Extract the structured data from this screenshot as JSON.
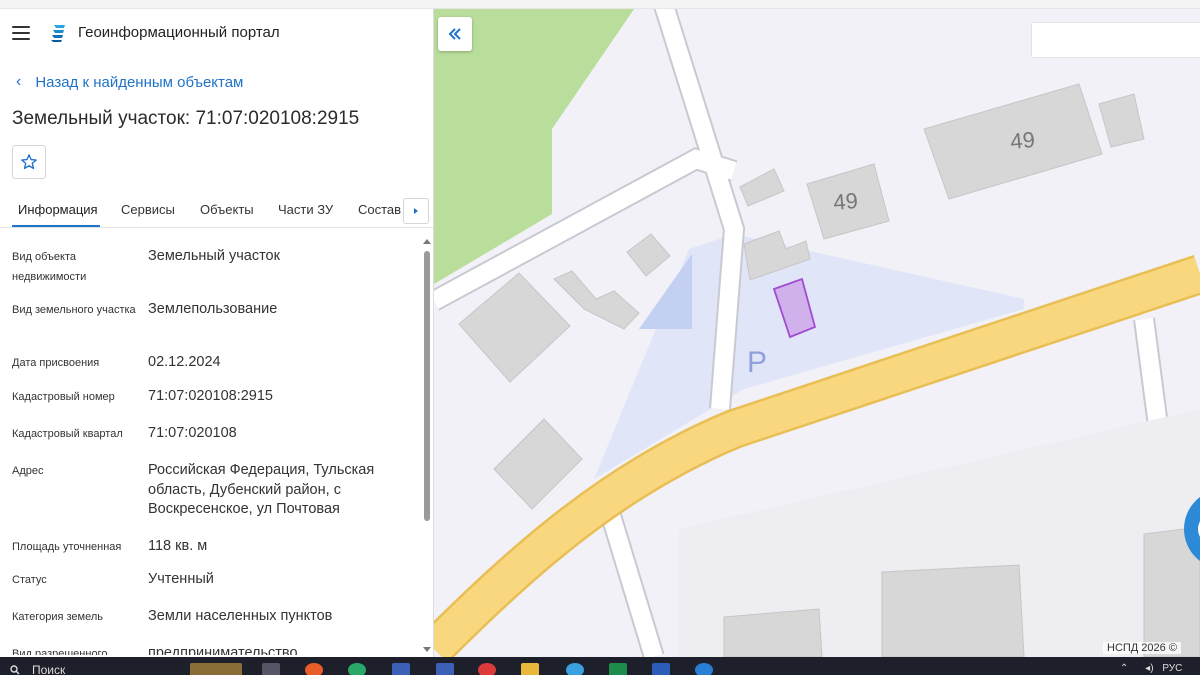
{
  "header": {
    "menu_icon": "hamburger-icon",
    "logo_icon": "portal-logo-icon",
    "title": "Геоинформационный портал"
  },
  "nav": {
    "back_label": "Назад к найденным объектам"
  },
  "object": {
    "title": "Земельный участок: 71:07:020108:2915",
    "favorite_icon": "star-icon"
  },
  "tabs": [
    {
      "label": "Информация",
      "active": true
    },
    {
      "label": "Сервисы",
      "active": false
    },
    {
      "label": "Объекты",
      "active": false
    },
    {
      "label": "Части ЗУ",
      "active": false
    },
    {
      "label": "Состав",
      "active": false
    }
  ],
  "properties": [
    {
      "label": "Вид объекта недвижимости",
      "value": "Земельный участок"
    },
    {
      "label": "Вид земельного участка",
      "value": "Землепользование"
    },
    {
      "label": "Дата присвоения",
      "value": "02.12.2024"
    },
    {
      "label": "Кадастровый номер",
      "value": "71:07:020108:2915"
    },
    {
      "label": "Кадастровый квартал",
      "value": "71:07:020108"
    },
    {
      "label": "Адрес",
      "value": "Российская Федерация, Тульская область, Дубенский район, с Воскресенское, ул Почтовая"
    },
    {
      "label": "Площадь уточненная",
      "value": "118 кв. м"
    },
    {
      "label": "Статус",
      "value": "Учтенный"
    },
    {
      "label": "Категория земель",
      "value": "Земли населенных пунктов"
    },
    {
      "label": "Вид разрешенного",
      "value": "предпринимательство"
    }
  ],
  "map": {
    "labels": {
      "house_number_1": "49",
      "house_number_2": "49",
      "parking": "P"
    },
    "attribution": "НСПД 2026 ©",
    "colors": {
      "road_major": "#f9d77e",
      "road_major_edge": "#e9bf55",
      "green": "#b9dd9a",
      "building": "#d7d7d7",
      "parcel": "#b26ad8",
      "parking_area": "#dfe5f8"
    }
  },
  "taskbar": {
    "search_label": "Поиск",
    "tray_lang": "РУС"
  }
}
